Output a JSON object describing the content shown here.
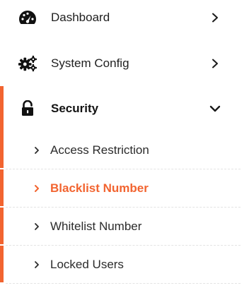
{
  "colors": {
    "accent": "#f26430",
    "text": "#1f1f1f"
  },
  "menu": {
    "items": [
      {
        "label": "Dashboard",
        "icon": "dashboard-gauge-icon",
        "expanded": false
      },
      {
        "label": "System Config",
        "icon": "gears-icon",
        "expanded": false
      },
      {
        "label": "Security",
        "icon": "lock-open-icon",
        "expanded": true
      }
    ],
    "security_children": [
      {
        "label": "Access Restriction",
        "active": false
      },
      {
        "label": "Blacklist Number",
        "active": true
      },
      {
        "label": "Whitelist Number",
        "active": false
      },
      {
        "label": "Locked Users",
        "active": false
      }
    ]
  }
}
